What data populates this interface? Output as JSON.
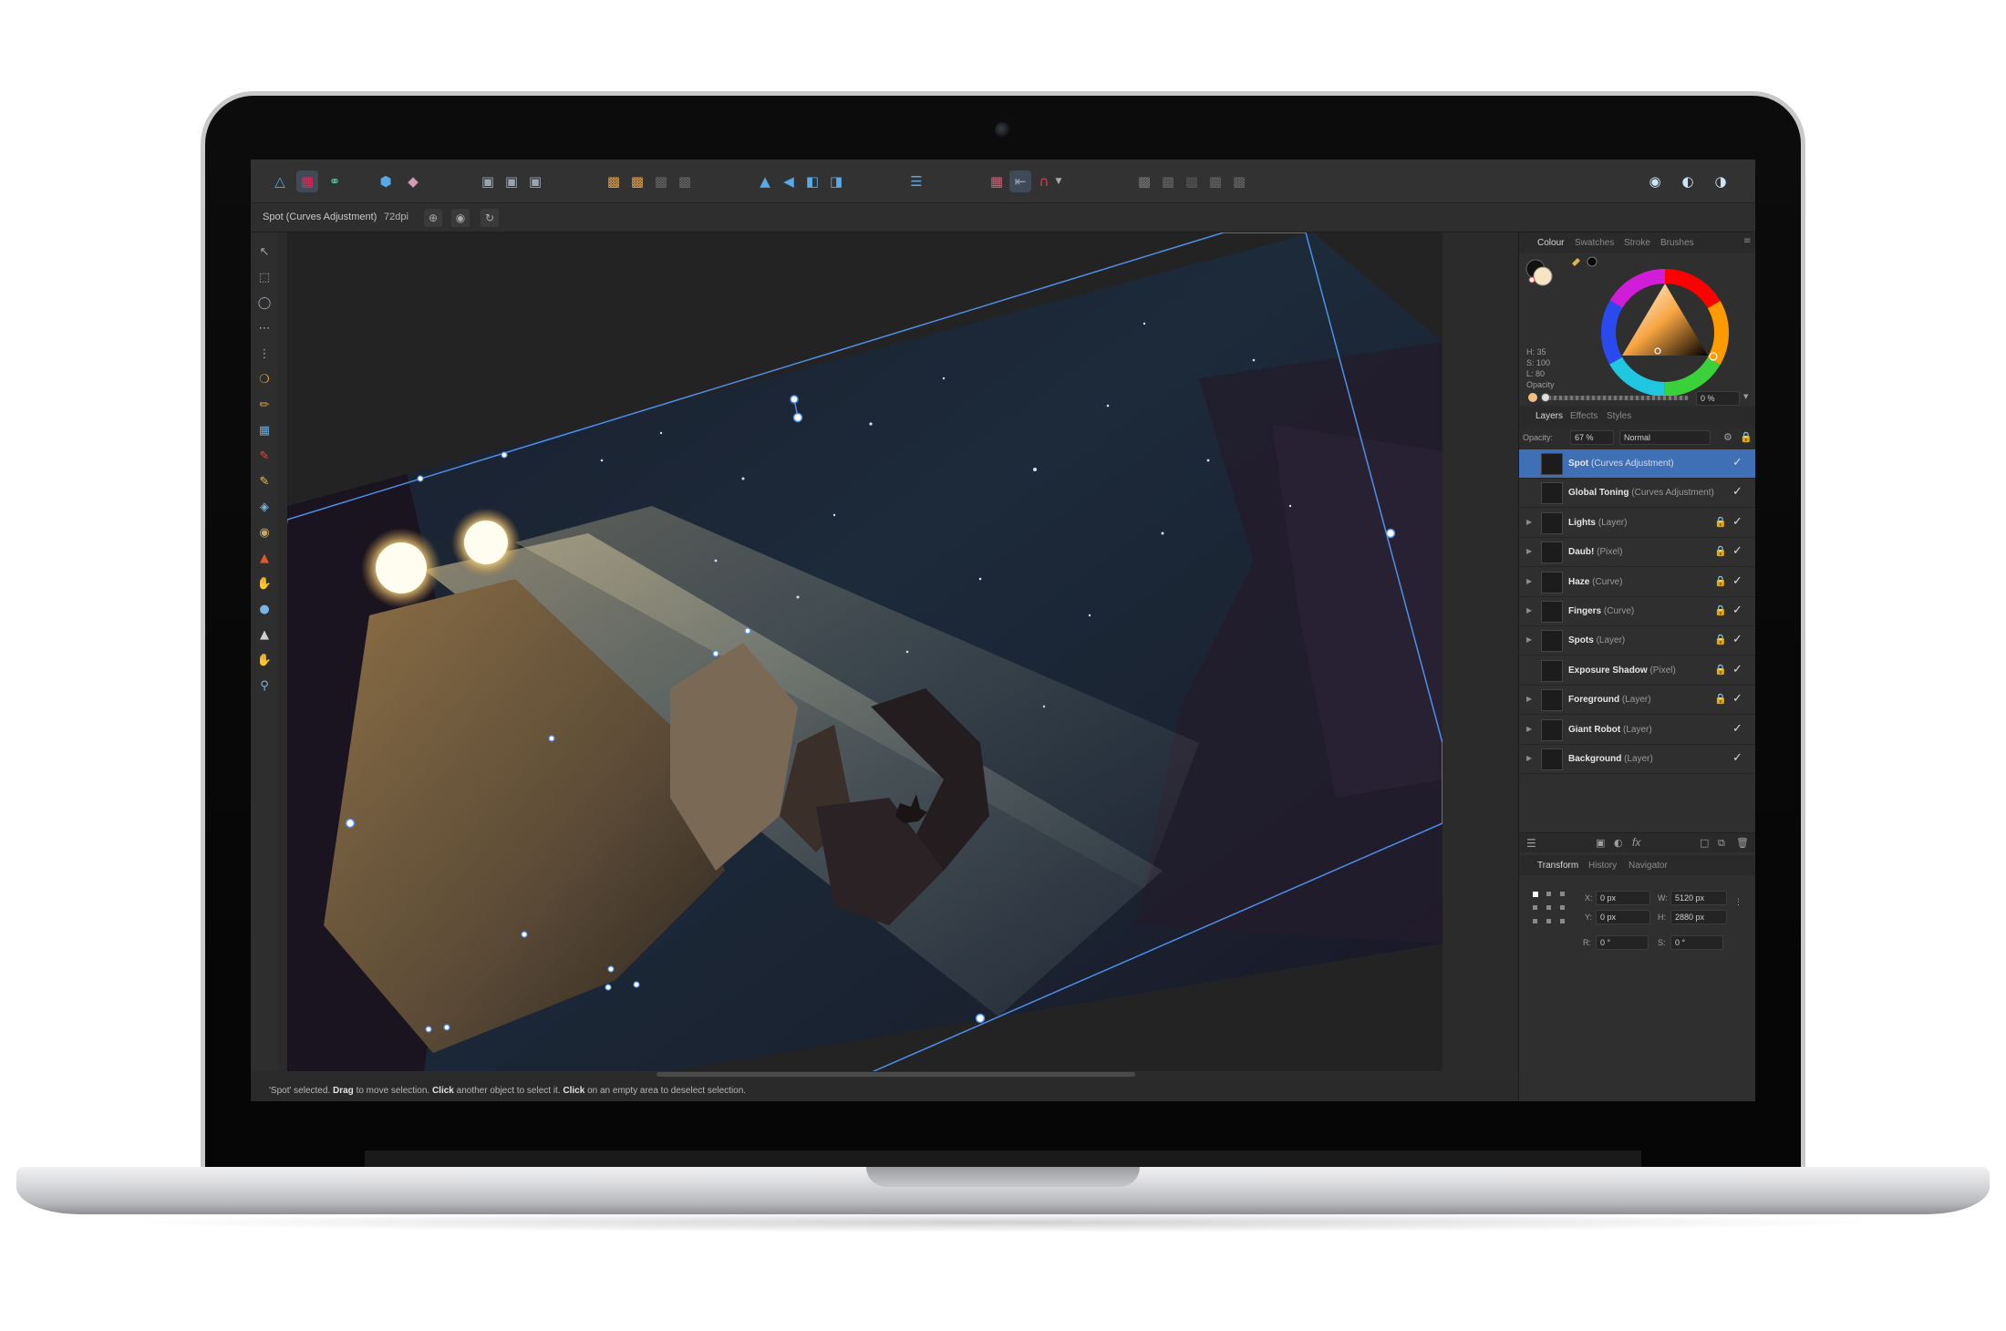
{
  "context": {
    "selection": "Spot (Curves Adjustment)",
    "dpi": "72dpi"
  },
  "toolbar": {
    "icons": [
      "affinity-logo-icon",
      "pixel-persona-icon",
      "export-persona-icon",
      "snapping-icon",
      "assistant-icon",
      "selection-insert-icon",
      "selection-above-icon",
      "selection-below-icon",
      "arrange-back-icon",
      "arrange-forward-icon",
      "arrange-front-icon",
      "arrange-top-icon",
      "flip-horizontal-icon",
      "flip-vertical-icon",
      "rotate-left-icon",
      "rotate-right-icon",
      "align-icon",
      "grid-icon",
      "bounds-icon",
      "snap-magnet-icon",
      "boolean-add-icon",
      "boolean-subtract-icon",
      "boolean-intersect-icon",
      "boolean-xor-icon",
      "boolean-divide-icon",
      "quick-mask-icon",
      "persona-studio-icon",
      "color-mode-icon"
    ]
  },
  "colour_panel": {
    "tabs": [
      "Colour",
      "Swatches",
      "Stroke",
      "Brushes"
    ],
    "h": "H: 35",
    "s": "S: 100",
    "l": "L: 80",
    "opacity_label": "Opacity",
    "opacity_value": "0 %"
  },
  "layers_panel": {
    "tabs": [
      "Layers",
      "Effects",
      "Styles"
    ],
    "opacity_label": "Opacity:",
    "opacity_value": "67 %",
    "blend_mode": "Normal",
    "layers": [
      {
        "name": "Spot",
        "type": "(Curves Adjustment)",
        "selected": true,
        "expandable": false,
        "locked": false
      },
      {
        "name": "Global Toning",
        "type": "(Curves Adjustment)",
        "selected": false,
        "expandable": false,
        "locked": false
      },
      {
        "name": "Lights",
        "type": "(Layer)",
        "selected": false,
        "expandable": true,
        "locked": true
      },
      {
        "name": "Daub!",
        "type": "(Pixel)",
        "selected": false,
        "expandable": true,
        "locked": true
      },
      {
        "name": "Haze",
        "type": "(Curve)",
        "selected": false,
        "expandable": true,
        "locked": true
      },
      {
        "name": "Fingers",
        "type": "(Curve)",
        "selected": false,
        "expandable": true,
        "locked": true
      },
      {
        "name": "Spots",
        "type": "(Layer)",
        "selected": false,
        "expandable": true,
        "locked": true
      },
      {
        "name": "Exposure Shadow",
        "type": "(Pixel)",
        "selected": false,
        "expandable": false,
        "locked": true
      },
      {
        "name": "Foreground",
        "type": "(Layer)",
        "selected": false,
        "expandable": true,
        "locked": true
      },
      {
        "name": "Giant Robot",
        "type": "(Layer)",
        "selected": false,
        "expandable": true,
        "locked": false
      },
      {
        "name": "Background",
        "type": "(Layer)",
        "selected": false,
        "expandable": true,
        "locked": false
      }
    ]
  },
  "transform_panel": {
    "tabs": [
      "Transform",
      "History",
      "Navigator"
    ],
    "x_label": "X:",
    "x_value": "0 px",
    "y_label": "Y:",
    "y_value": "0 px",
    "w_label": "W:",
    "w_value": "5120 px",
    "h_label": "H:",
    "h_value": "2880 px",
    "r_label": "R:",
    "r_value": "0 °",
    "s_label": "S:",
    "s_value": "0 °"
  },
  "status": {
    "quote_sel": "'Spot' selected.",
    "drag": "Drag",
    "drag_rest": "to move selection.",
    "click1": "Click",
    "click1_rest": "another object to select it.",
    "click2": "Click",
    "click2_rest": "on an empty area to deselect selection."
  },
  "colors": {
    "accent": "#3f6fb5",
    "handle": "#4f8fe8",
    "panel_bg": "#2f2f2f"
  }
}
